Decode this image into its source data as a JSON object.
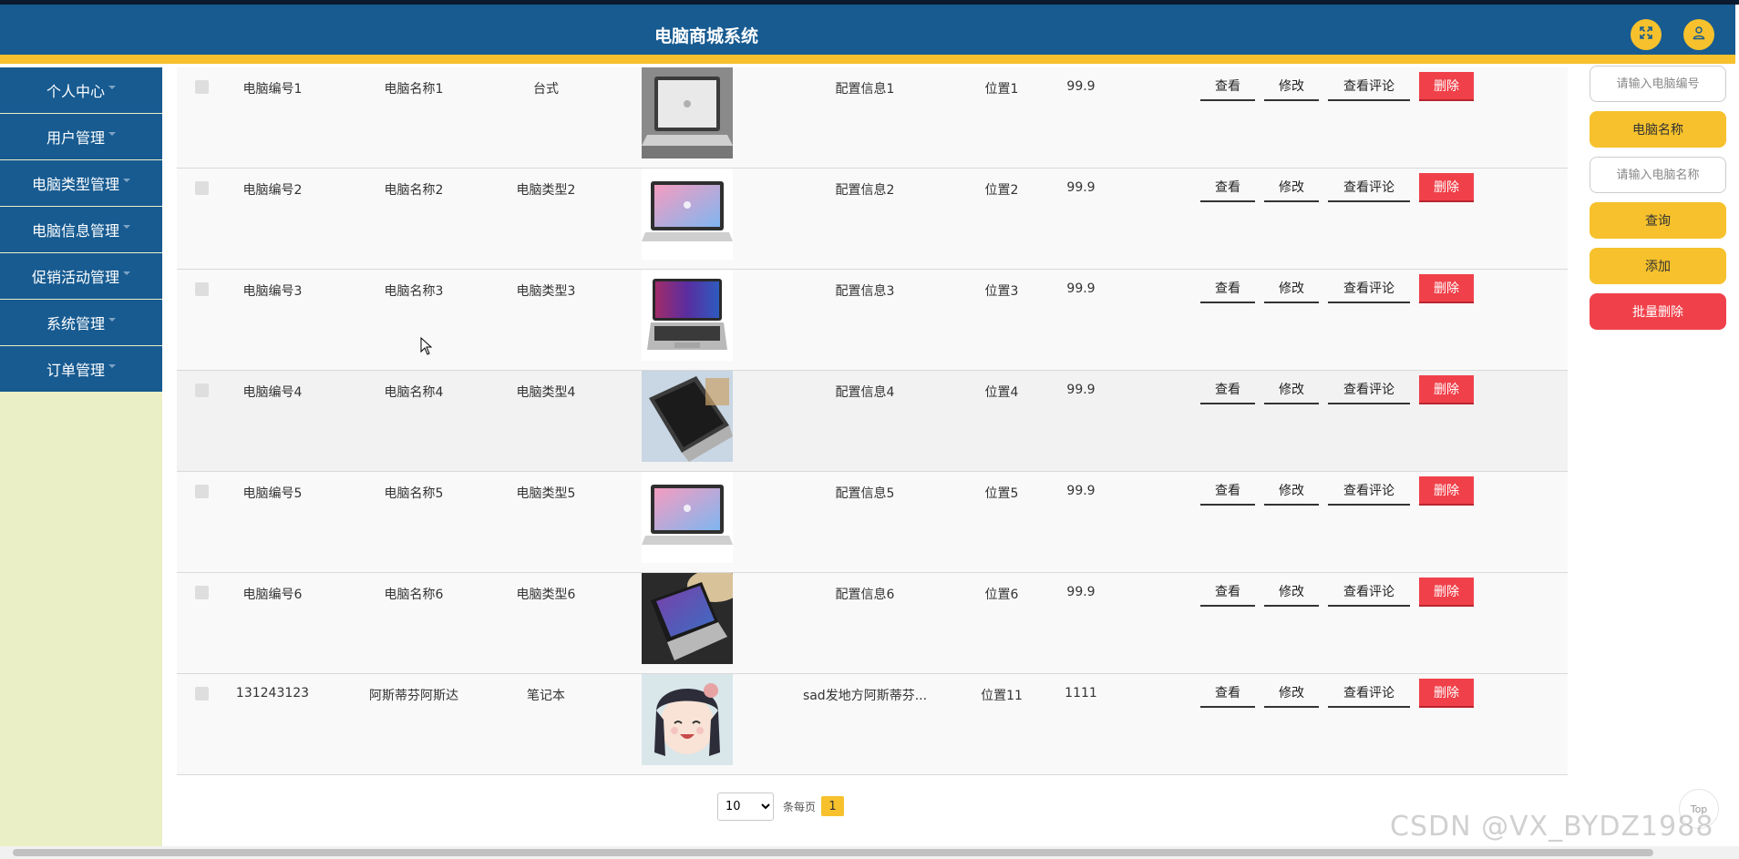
{
  "header": {
    "title": "电脑商城系统",
    "fullscreen_icon": "expand-icon",
    "user_icon": "user-icon"
  },
  "sidebar": {
    "items": [
      {
        "label": "个人中心"
      },
      {
        "label": "用户管理"
      },
      {
        "label": "电脑类型管理"
      },
      {
        "label": "电脑信息管理"
      },
      {
        "label": "促销活动管理"
      },
      {
        "label": "系统管理"
      },
      {
        "label": "订单管理"
      }
    ]
  },
  "table": {
    "rows": [
      {
        "code": "电脑编号1",
        "name": "电脑名称1",
        "type": "台式",
        "config": "配置信息1",
        "location": "位置1",
        "price": "99.9"
      },
      {
        "code": "电脑编号2",
        "name": "电脑名称2",
        "type": "电脑类型2",
        "config": "配置信息2",
        "location": "位置2",
        "price": "99.9"
      },
      {
        "code": "电脑编号3",
        "name": "电脑名称3",
        "type": "电脑类型3",
        "config": "配置信息3",
        "location": "位置3",
        "price": "99.9"
      },
      {
        "code": "电脑编号4",
        "name": "电脑名称4",
        "type": "电脑类型4",
        "config": "配置信息4",
        "location": "位置4",
        "price": "99.9"
      },
      {
        "code": "电脑编号5",
        "name": "电脑名称5",
        "type": "电脑类型5",
        "config": "配置信息5",
        "location": "位置5",
        "price": "99.9"
      },
      {
        "code": "电脑编号6",
        "name": "电脑名称6",
        "type": "电脑类型6",
        "config": "配置信息6",
        "location": "位置6",
        "price": "99.9"
      },
      {
        "code": "131243123",
        "name": "阿斯蒂芬阿斯达",
        "type": "笔记本",
        "config": "sad发地方阿斯蒂芬...",
        "location": "位置11",
        "price": "1111"
      }
    ],
    "actions": {
      "view": "查看",
      "edit": "修改",
      "view_comments": "查看评论",
      "delete": "删除"
    }
  },
  "pagination": {
    "page_size": "10",
    "page_size_options": [
      "10"
    ],
    "per_page_label": "条每页",
    "current_page": "1"
  },
  "right_panel": {
    "code_placeholder": "请输入电脑编号",
    "name_label": "电脑名称",
    "name_placeholder": "请输入电脑名称",
    "search_button": "查询",
    "add_button": "添加",
    "batch_delete_button": "批量删除"
  },
  "top_button": "Top",
  "watermark": "CSDN @VX_BYDZ1988",
  "colors": {
    "header_blue": "#175b91",
    "accent_yellow": "#f6c12c",
    "danger_red": "#f0414a",
    "sidebar_bg": "#ebefc5"
  }
}
